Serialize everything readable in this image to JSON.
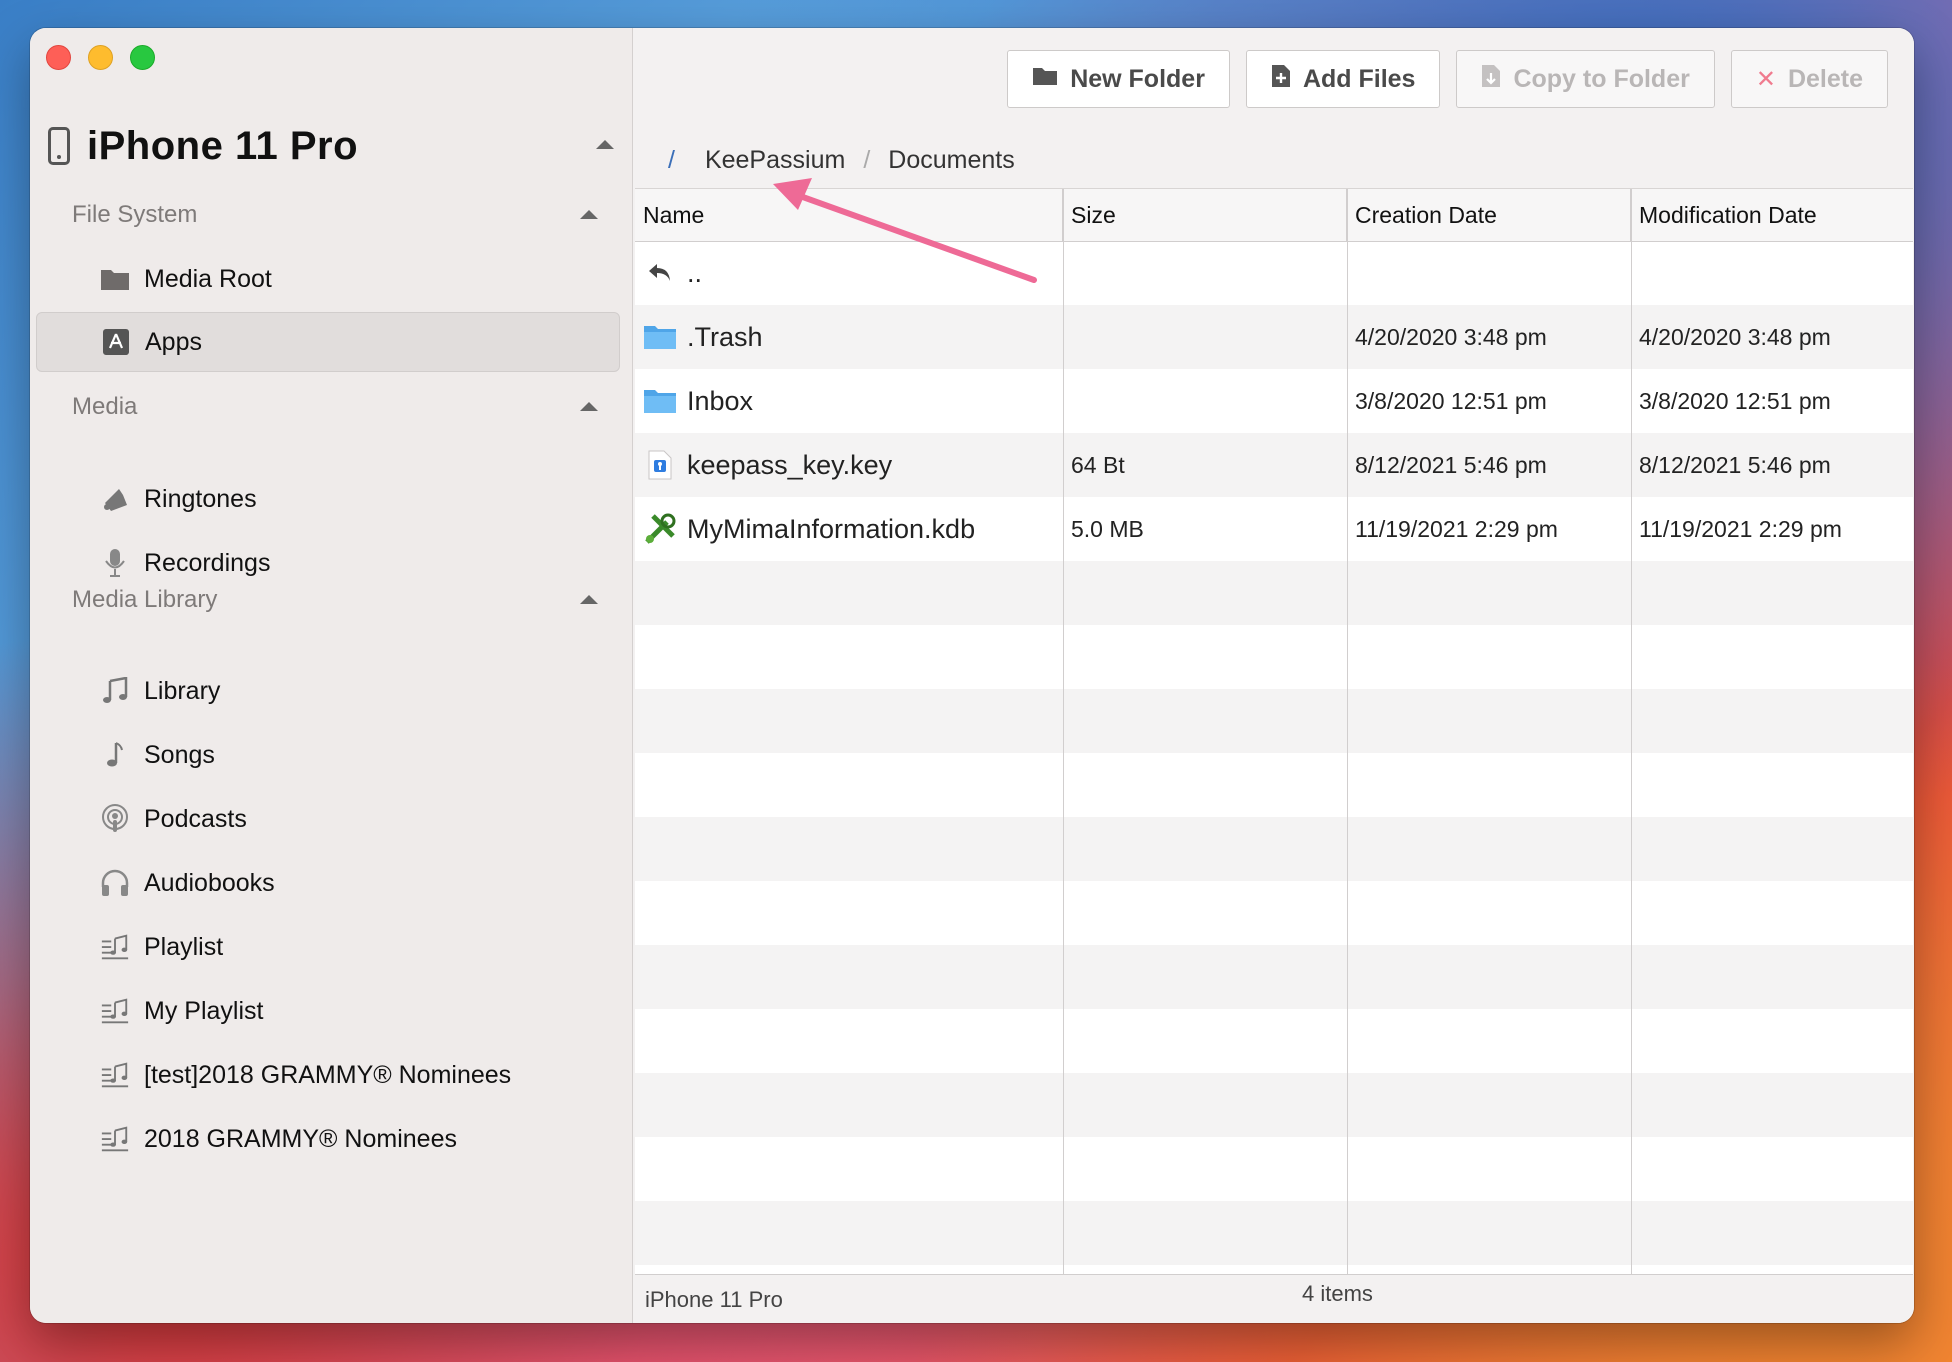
{
  "device": {
    "name": "iPhone 11 Pro"
  },
  "sidebar": {
    "sections": [
      {
        "label": "File System"
      },
      {
        "label": "Media"
      },
      {
        "label": "Media Library"
      }
    ],
    "items": [
      {
        "label": "Media Root",
        "icon": "folder-icon"
      },
      {
        "label": "Apps",
        "icon": "app-store-icon"
      },
      {
        "label": "Ringtones",
        "icon": "bell-icon"
      },
      {
        "label": "Recordings",
        "icon": "microphone-icon"
      },
      {
        "label": "Library",
        "icon": "music-note-icon"
      },
      {
        "label": "Songs",
        "icon": "single-note-icon"
      },
      {
        "label": "Podcasts",
        "icon": "podcast-icon"
      },
      {
        "label": "Audiobooks",
        "icon": "headphones-icon"
      },
      {
        "label": "Playlist",
        "icon": "playlist-icon"
      },
      {
        "label": "My Playlist",
        "icon": "playlist-icon"
      },
      {
        "label": "[test]2018 GRAMMY® Nominees",
        "icon": "playlist-icon"
      },
      {
        "label": "2018 GRAMMY® Nominees",
        "icon": "playlist-icon"
      }
    ]
  },
  "toolbar": {
    "new_folder": "New Folder",
    "add_files": "Add Files",
    "copy_to_folder": "Copy to Folder",
    "delete": "Delete"
  },
  "breadcrumb": {
    "root": "/",
    "parts": [
      "KeePassium",
      "Documents"
    ]
  },
  "table": {
    "headers": [
      "Name",
      "Size",
      "Creation Date",
      "Modification Date"
    ],
    "rows": [
      {
        "name": "..",
        "size": "",
        "created": "",
        "modified": "",
        "icon": "back-arrow-icon"
      },
      {
        "name": ".Trash",
        "size": "",
        "created": "4/20/2020 3:48 pm",
        "modified": "4/20/2020 3:48 pm",
        "icon": "folder-icon"
      },
      {
        "name": "Inbox",
        "size": "",
        "created": "3/8/2020 12:51 pm",
        "modified": "3/8/2020 12:51 pm",
        "icon": "folder-icon"
      },
      {
        "name": "keepass_key.key",
        "size": "64 Bt",
        "created": "8/12/2021 5:46 pm",
        "modified": "8/12/2021 5:46 pm",
        "icon": "key-file-icon"
      },
      {
        "name": "MyMimaInformation.kdb",
        "size": "5.0 MB",
        "created": "11/19/2021 2:29 pm",
        "modified": "11/19/2021 2:29 pm",
        "icon": "keepass-db-icon"
      }
    ]
  },
  "status": {
    "device": "iPhone 11 Pro",
    "count": "4 items"
  },
  "colors": {
    "accent_arrow": "#ee6a96",
    "breadcrumb_root": "#3b6fb8"
  }
}
